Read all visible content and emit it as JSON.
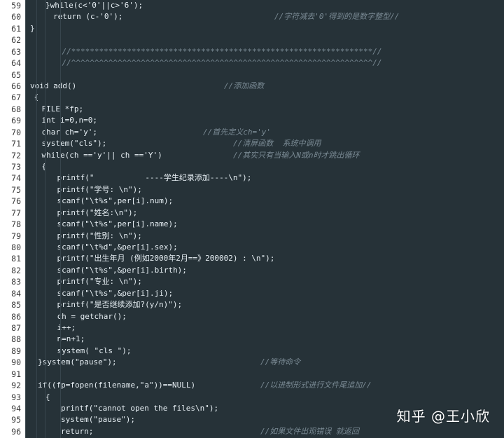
{
  "editor": {
    "colors": {
      "background": "#263238",
      "gutter": "#ffffff",
      "text": "#e6eef3",
      "comment": "#7a8a94"
    },
    "lines": [
      {
        "n": "59",
        "indent": 4,
        "code": "}while(c<'0'||c>'6');",
        "comment": ""
      },
      {
        "n": "60",
        "indent": 6,
        "code": "return (c-'0');",
        "comment": "//字符减去'0'得到的是数字整型//"
      },
      {
        "n": "61",
        "indent": 0,
        "code": "}",
        "comment": ""
      },
      {
        "n": "62",
        "indent": 0,
        "code": "",
        "comment": ""
      },
      {
        "n": "63",
        "indent": 0,
        "code": "",
        "comment": "    //*****************************************************************//"
      },
      {
        "n": "64",
        "indent": 0,
        "code": "",
        "comment": "    //^^^^^^^^^^^^^^^^^^^^^^^^^^^^^^^^^^^^^^^^^^^^^^^^^^^^^^^^^^^^^^^^^//"
      },
      {
        "n": "65",
        "indent": 0,
        "code": "",
        "comment": ""
      },
      {
        "n": "66",
        "indent": 0,
        "code": "void add()",
        "comment": "//添加函数"
      },
      {
        "n": "67",
        "indent": 1,
        "code": "{",
        "comment": ""
      },
      {
        "n": "68",
        "indent": 3,
        "code": "FILE *fp;",
        "comment": ""
      },
      {
        "n": "69",
        "indent": 3,
        "code": "int i=0,n=0;",
        "comment": ""
      },
      {
        "n": "70",
        "indent": 3,
        "code": "char ch='y';",
        "comment": "//首先定义ch='y'"
      },
      {
        "n": "71",
        "indent": 3,
        "code": "system(\"cls\");",
        "comment": "//清屏函数  系统中调用"
      },
      {
        "n": "72",
        "indent": 3,
        "code": "while(ch =='y'|| ch =='Y')",
        "comment": "//其实只有当输入N或n时才跳出循环"
      },
      {
        "n": "73",
        "indent": 3,
        "code": "{",
        "comment": ""
      },
      {
        "n": "74",
        "indent": 7,
        "code": "printf(\"           ----学生纪录添加----\\n\");",
        "comment": ""
      },
      {
        "n": "75",
        "indent": 7,
        "code": "printf(\"学号: \\n\");",
        "comment": ""
      },
      {
        "n": "76",
        "indent": 7,
        "code": "scanf(\"\\t%s\",per[i].num);",
        "comment": ""
      },
      {
        "n": "77",
        "indent": 7,
        "code": "printf(\"姓名:\\n\");",
        "comment": ""
      },
      {
        "n": "78",
        "indent": 7,
        "code": "scanf(\"\\t%s\",per[i].name);",
        "comment": ""
      },
      {
        "n": "79",
        "indent": 7,
        "code": "printf(\"性别: \\n\");",
        "comment": ""
      },
      {
        "n": "80",
        "indent": 7,
        "code": "scanf(\"\\t%d\",&per[i].sex);",
        "comment": ""
      },
      {
        "n": "81",
        "indent": 7,
        "code": "printf(\"出生年月 (例如2000年2月==》200002) : \\n\");",
        "comment": ""
      },
      {
        "n": "82",
        "indent": 7,
        "code": "scanf(\"\\t%s\",&per[i].birth);",
        "comment": ""
      },
      {
        "n": "83",
        "indent": 7,
        "code": "printf(\"专业: \\n\");",
        "comment": ""
      },
      {
        "n": "84",
        "indent": 7,
        "code": "scanf(\"\\t%s\",&per[i].ji);",
        "comment": ""
      },
      {
        "n": "85",
        "indent": 7,
        "code": "printf(\"是否继续添加?(y/n)\");",
        "comment": ""
      },
      {
        "n": "86",
        "indent": 7,
        "code": "ch = getchar();",
        "comment": ""
      },
      {
        "n": "87",
        "indent": 7,
        "code": "i++;",
        "comment": ""
      },
      {
        "n": "88",
        "indent": 7,
        "code": "n=n+1;",
        "comment": ""
      },
      {
        "n": "89",
        "indent": 7,
        "code": "system( \"cls \");",
        "comment": ""
      },
      {
        "n": "90",
        "indent": 2,
        "code": "}system(\"pause\");",
        "comment": "//等待命令"
      },
      {
        "n": "91",
        "indent": 0,
        "code": "",
        "comment": ""
      },
      {
        "n": "92",
        "indent": 2,
        "code": "if((fp=fopen(filename,\"a\"))==NULL)",
        "comment": "//以进制形式进行文件尾追加//"
      },
      {
        "n": "93",
        "indent": 4,
        "code": "{",
        "comment": ""
      },
      {
        "n": "94",
        "indent": 8,
        "code": "printf(\"cannot open the files\\n\");",
        "comment": ""
      },
      {
        "n": "95",
        "indent": 8,
        "code": "system(\"pause\");",
        "comment": ""
      },
      {
        "n": "96",
        "indent": 8,
        "code": "return;",
        "comment": "//如果文件出现错误 就返回"
      }
    ]
  },
  "watermark": "知乎 @王小欣"
}
